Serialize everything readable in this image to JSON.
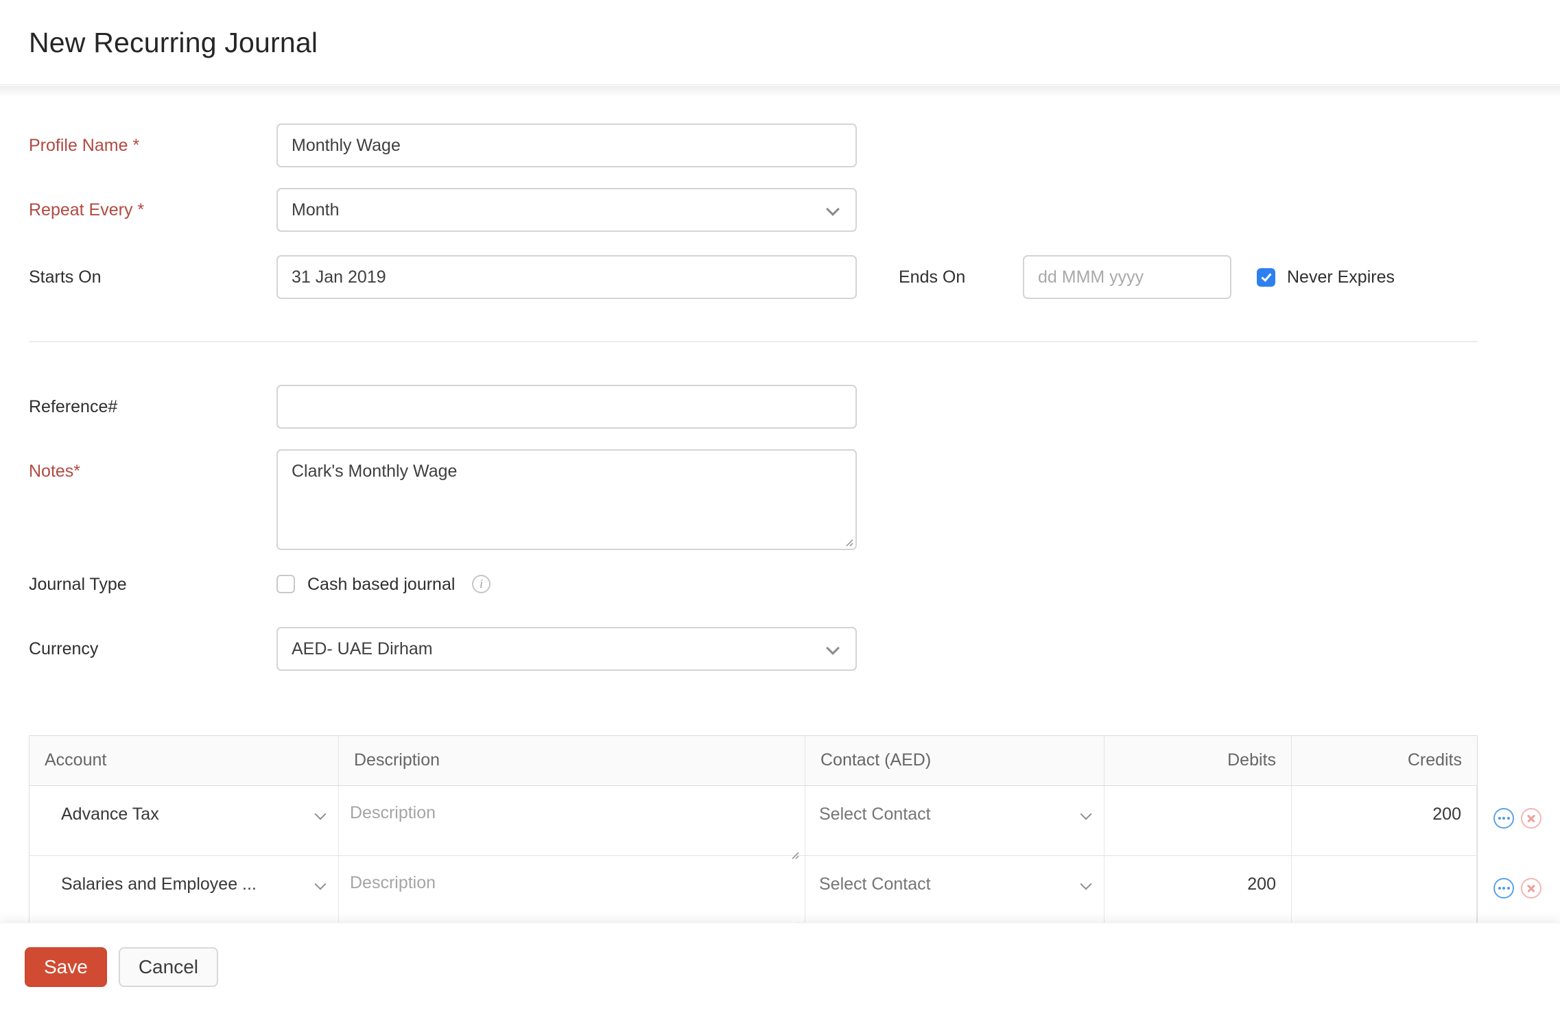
{
  "page": {
    "title": "New Recurring Journal"
  },
  "form": {
    "profile_name": {
      "label": "Profile Name *",
      "value": "Monthly Wage"
    },
    "repeat_every": {
      "label": "Repeat Every *",
      "value": "Month"
    },
    "starts_on": {
      "label": "Starts On",
      "value": "31 Jan 2019"
    },
    "ends_on": {
      "label": "Ends On",
      "placeholder": "dd MMM yyyy"
    },
    "never_expires": {
      "label": "Never Expires",
      "checked": true
    },
    "reference": {
      "label": "Reference#",
      "value": ""
    },
    "notes": {
      "label": "Notes*",
      "value": "Clark's Monthly Wage"
    },
    "journal_type": {
      "label": "Journal Type",
      "checkbox_label": "Cash based journal",
      "checked": false
    },
    "currency": {
      "label": "Currency",
      "value": "AED- UAE Dirham"
    }
  },
  "table": {
    "headers": {
      "account": "Account",
      "description": "Description",
      "contact": "Contact (AED)",
      "debits": "Debits",
      "credits": "Credits"
    },
    "rows": [
      {
        "account": "Advance Tax",
        "description_placeholder": "Description",
        "contact": "Select Contact",
        "debits": "",
        "credits": "200"
      },
      {
        "account": "Salaries and Employee ...",
        "description_placeholder": "Description",
        "contact": "Select Contact",
        "debits": "200",
        "credits": ""
      }
    ]
  },
  "footer": {
    "save_label": "Save",
    "cancel_label": "Cancel"
  },
  "icons": {
    "info_glyph": "i"
  },
  "colors": {
    "required_label_red": "#b04a42",
    "checkbox_blue": "#2e80f0",
    "save_button_red": "#d04b32",
    "more_icon_blue": "#4a9be6",
    "remove_icon_pink": "#eda09c",
    "table_header_bg": "#fafafa"
  }
}
